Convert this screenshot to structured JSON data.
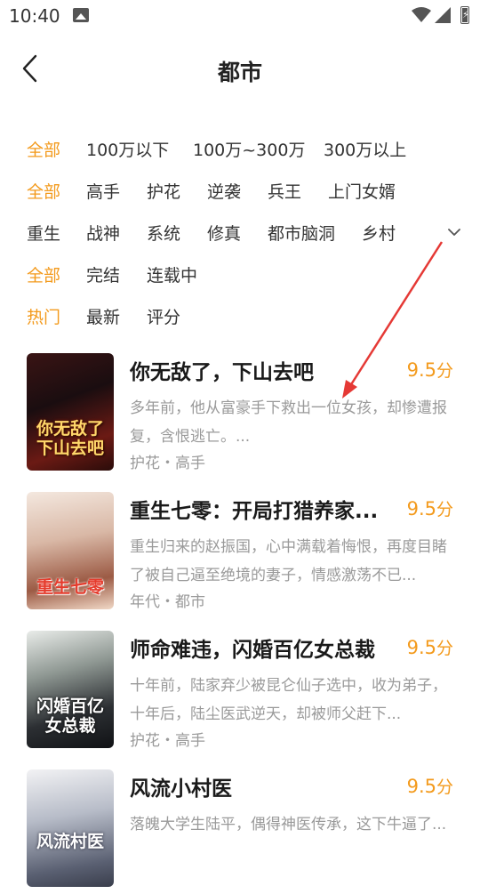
{
  "status_bar": {
    "time": "10:40",
    "icons": [
      "gallery-icon",
      "wifi-icon",
      "cellular-signal-icon",
      "battery-charging-icon"
    ]
  },
  "header": {
    "title": "都市",
    "back_icon": "chevron-left-icon"
  },
  "filters": {
    "word_count": [
      "全部",
      "100万以下",
      "100万~300万",
      "300万以上"
    ],
    "category": [
      "全部",
      "高手",
      "护花",
      "逆袭",
      "兵王",
      "上门女婿",
      "重生",
      "战神",
      "系统",
      "修真",
      "都市脑洞",
      "乡村"
    ],
    "status": [
      "全部",
      "完结",
      "连载中"
    ],
    "sort": [
      "热门",
      "最新",
      "评分"
    ],
    "expand_icon": "chevron-down-icon"
  },
  "books": [
    {
      "title": "你无敌了，下山去吧",
      "rating": "9.5",
      "rating_unit": "分",
      "description": "多年前，他从富豪手下救出一位女孩，却惨遭报复，含恨逃亡。...",
      "tags": "护花・高手",
      "cover_text": "你无敌了下山去吧"
    },
    {
      "title": "重生七零：开局打猎养家...",
      "rating": "9.5",
      "rating_unit": "分",
      "description": "重生归来的赵振国，心中满载着悔恨，再度目睹了被自己逼至绝境的妻子，情感激荡不已...",
      "tags": "年代・都市",
      "cover_text": "重生七零"
    },
    {
      "title": "师命难违，闪婚百亿女总裁",
      "rating": "9.5",
      "rating_unit": "分",
      "description": "十年前，陆家弃少被昆仑仙子选中，收为弟子，十年后，陆尘医武逆天，却被师父赶下...",
      "tags": "护花・高手",
      "cover_text": "闪婚百亿女总裁"
    },
    {
      "title": "风流小村医",
      "rating": "9.5",
      "rating_unit": "分",
      "description": "落魄大学生陆平，偶得神医传承，这下牛逼了...",
      "tags": "",
      "cover_text": "风流村医"
    }
  ],
  "colors": {
    "accent": "#f39a1c",
    "annotation_arrow": "#e53935",
    "muted_text": "#9a9a9a"
  }
}
